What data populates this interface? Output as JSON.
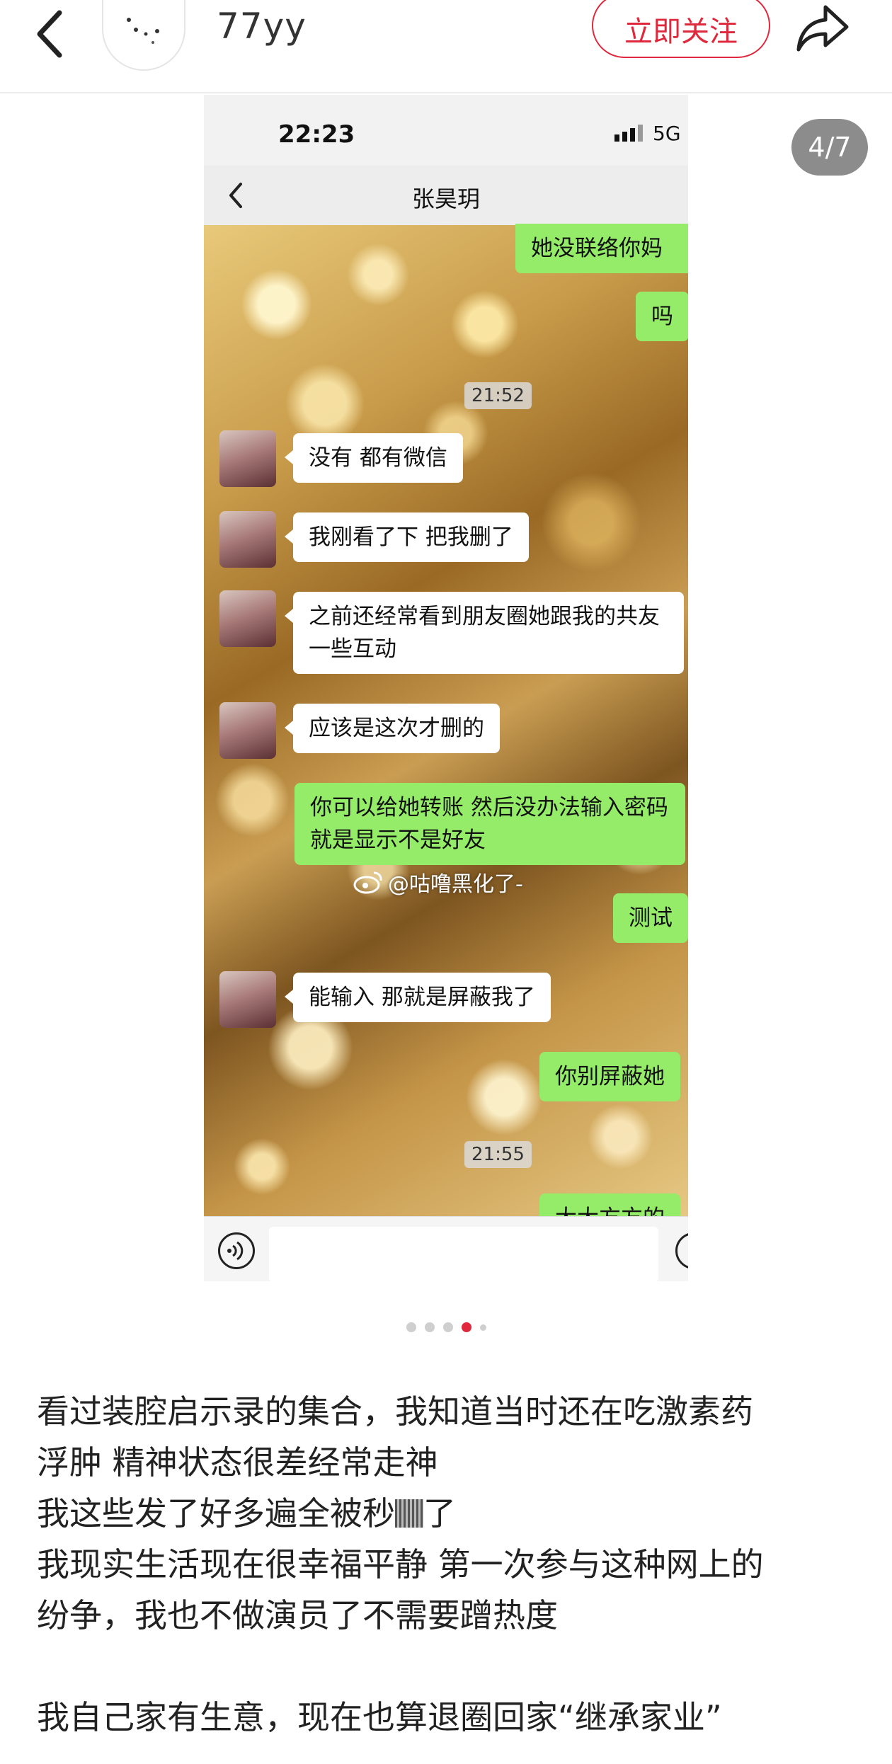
{
  "header": {
    "username": "77yy",
    "follow_label": "立即关注"
  },
  "viewer": {
    "counter": "4/7",
    "total": 7,
    "current": 4
  },
  "phone": {
    "status_time": "22:23",
    "network": "5G",
    "contact_name": "张昊玥"
  },
  "chat": {
    "m1": "她没联络你妈",
    "m2": "吗",
    "ts1": "21:52",
    "m3": "没有 都有微信",
    "m4": "我刚看了下 把我删了",
    "m5": "之前还经常看到朋友圈她跟我的共友一些互动",
    "m6": "应该是这次才删的",
    "m7": "你可以给她转账 然后没办法输入密码就是显示不是好友",
    "m8": "测试",
    "m9": "能输入 那就是屏蔽我了",
    "m10": "你别屏蔽她",
    "ts2": "21:55",
    "m11": "大大方方的"
  },
  "watermark": "@咕噜黑化了-",
  "post": {
    "line1": "看过装腔启示录的集合，我知道当时还在吃激素药",
    "line2": "浮肿 精神状态很差经常走神",
    "line3a": "我这些发了好多遍全被秒",
    "line3b": "了",
    "line4": "我现实生活现在很幸福平静 第一次参与这种网上的",
    "line5": "纷争，我也不做演员了不需要蹭热度",
    "line6": "我自己家有生意，现在也算退圈回家“继承家业”"
  },
  "colors": {
    "accent": "#e0283c",
    "bubble_me": "#95ec69",
    "bubble_them": "#ffffff"
  },
  "icons": [
    "back-arrow-icon",
    "share-icon",
    "signal-icon",
    "voice-icon",
    "emoji-icon",
    "weibo-icon"
  ]
}
